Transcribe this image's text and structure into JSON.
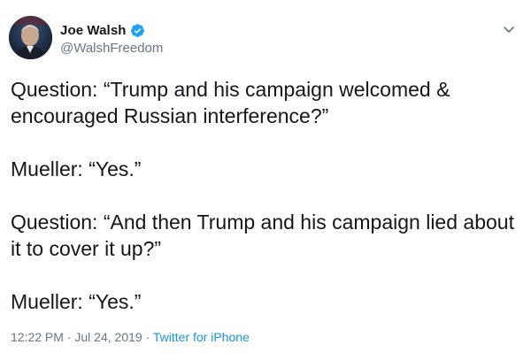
{
  "author": {
    "display_name": "Joe Walsh",
    "handle": "@WalshFreedom",
    "verified": true
  },
  "icons": {
    "verified": "verified-badge-icon",
    "more": "chevron-down-icon"
  },
  "colors": {
    "text": "#14171a",
    "secondary": "#657786",
    "link": "#1b95e0",
    "verified": "#1da1f2"
  },
  "tweet": {
    "paragraphs": [
      "Question: “Trump and his campaign welcomed & encouraged Russian interference?”",
      "Mueller: “Yes.”",
      "Question: “And then Trump and his campaign lied about it to cover it up?”",
      "Mueller: “Yes.”"
    ],
    "time": "12:22 PM",
    "separator": " · ",
    "date": "Jul 24, 2019",
    "source": "Twitter for iPhone"
  }
}
